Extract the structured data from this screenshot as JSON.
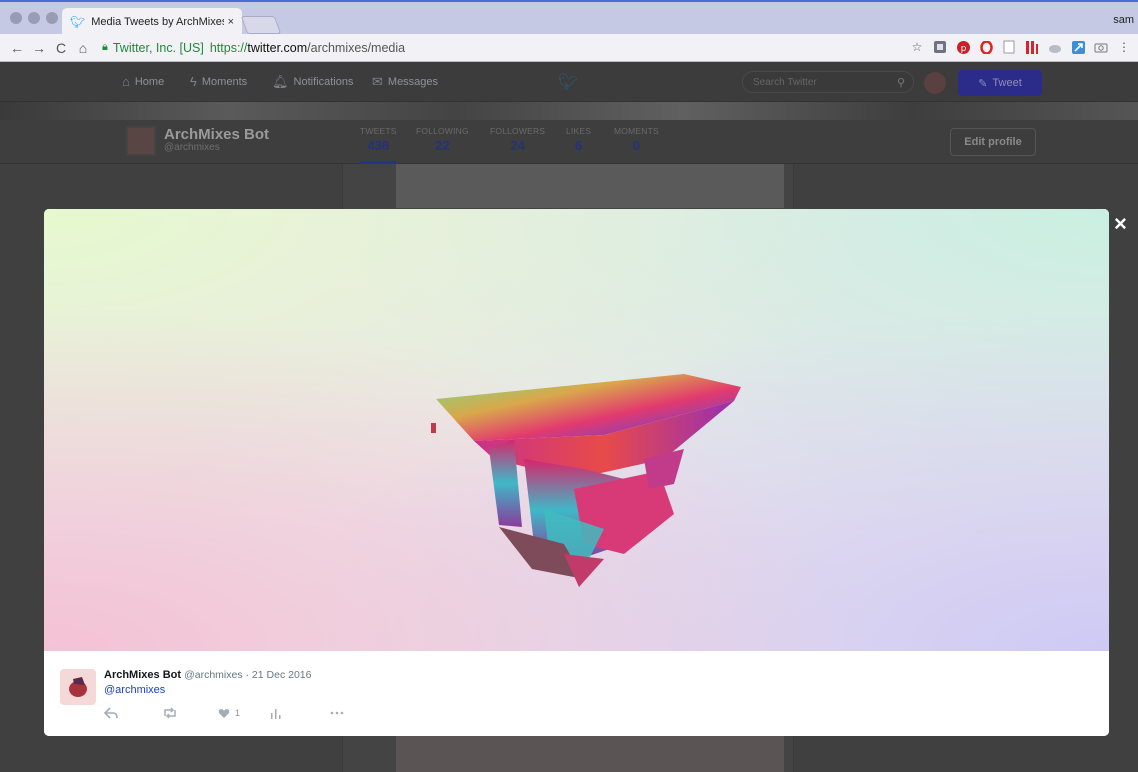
{
  "browser": {
    "tab_title": "Media Tweets by ArchMixes Bo",
    "tab_close": "×",
    "user": "sam",
    "nav": {
      "back": "←",
      "forward": "→",
      "reload": "C",
      "home": "⌂"
    },
    "url": {
      "org": "Twitter, Inc. [US]",
      "scheme": "https://",
      "host": "twitter.com",
      "path": "/archmixes/media"
    }
  },
  "twitter_nav": {
    "home": "Home",
    "moments": "Moments",
    "notifications": "Notifications",
    "messages": "Messages",
    "search_placeholder": "Search Twitter",
    "tweet_button": "Tweet"
  },
  "profile": {
    "name": "ArchMixes Bot",
    "handle": "@archmixes",
    "stats": [
      {
        "label": "TWEETS",
        "value": "438"
      },
      {
        "label": "FOLLOWING",
        "value": "22"
      },
      {
        "label": "FOLLOWERS",
        "value": "24"
      },
      {
        "label": "LIKES",
        "value": "6"
      },
      {
        "label": "MOMENTS",
        "value": "0"
      }
    ],
    "edit_profile": "Edit profile"
  },
  "modal": {
    "close": "×",
    "tweet": {
      "name": "ArchMixes Bot",
      "handle_date": "@archmixes · 21 Dec 2016",
      "text": "@archmixes",
      "likes": "1"
    }
  }
}
